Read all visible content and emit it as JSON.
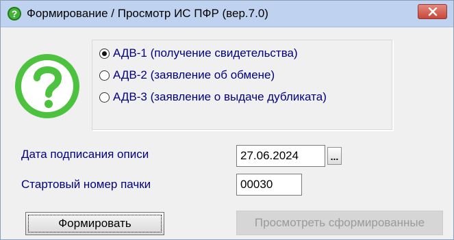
{
  "window": {
    "title": "Формирование / Просмотр ИС ПФР (вер.7.0)",
    "title_icon": "help-circle-icon",
    "close_icon": "close-icon",
    "titlebar_color": "#bfd3f0",
    "close_color": "#c8463a"
  },
  "big_icon": {
    "name": "question-mark-icon",
    "color": "#4cc23f"
  },
  "options": {
    "items": [
      {
        "label": "АДВ-1 (получение свидетельства)",
        "checked": true
      },
      {
        "label": "АДВ-2 (заявление об обмене)",
        "checked": false
      },
      {
        "label": "АДВ-3 (заявление о выдаче дубликата)",
        "checked": false
      }
    ]
  },
  "fields": {
    "date_label": "Дата подписания описи",
    "date_value": "27.06.2024",
    "dots_label": "...",
    "start_label": "Стартовый номер пачки",
    "start_value": "00030"
  },
  "buttons": {
    "form": "Формировать",
    "view": "Просмотреть сформированные"
  },
  "colors": {
    "label_text": "#000080",
    "disabled_text": "#9a9a9a"
  }
}
